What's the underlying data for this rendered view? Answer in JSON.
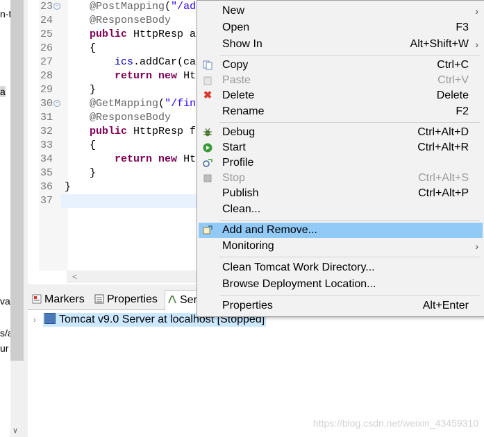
{
  "left_strip": {
    "fragments": [
      "n-t",
      "a",
      "va",
      "s/a",
      "ur"
    ]
  },
  "editor": {
    "lines": [
      {
        "n": "23",
        "fold": true,
        "parts": [
          {
            "t": "    ",
            "c": ""
          },
          {
            "t": "@PostMapping",
            "c": "ann"
          },
          {
            "t": "(",
            "c": ""
          },
          {
            "t": "\"/add",
            "c": "str"
          }
        ]
      },
      {
        "n": "24",
        "fold": false,
        "parts": [
          {
            "t": "    ",
            "c": ""
          },
          {
            "t": "@ResponseBody",
            "c": "ann"
          }
        ]
      },
      {
        "n": "25",
        "fold": false,
        "parts": [
          {
            "t": "    ",
            "c": ""
          },
          {
            "t": "public",
            "c": "kw"
          },
          {
            "t": " HttpResp ad",
            "c": ""
          }
        ]
      },
      {
        "n": "26",
        "fold": false,
        "parts": [
          {
            "t": "    {",
            "c": ""
          }
        ]
      },
      {
        "n": "27",
        "fold": false,
        "parts": [
          {
            "t": "        ",
            "c": ""
          },
          {
            "t": "ics",
            "c": "fld"
          },
          {
            "t": ".addCar(car",
            "c": ""
          }
        ]
      },
      {
        "n": "28",
        "fold": false,
        "parts": [
          {
            "t": "        ",
            "c": ""
          },
          {
            "t": "return",
            "c": "kw"
          },
          {
            "t": " ",
            "c": ""
          },
          {
            "t": "new",
            "c": "kw"
          },
          {
            "t": " Htt",
            "c": ""
          }
        ]
      },
      {
        "n": "29",
        "fold": false,
        "parts": [
          {
            "t": "    }",
            "c": ""
          }
        ]
      },
      {
        "n": "30",
        "fold": true,
        "parts": [
          {
            "t": "    ",
            "c": ""
          },
          {
            "t": "@GetMapping",
            "c": "ann"
          },
          {
            "t": "(",
            "c": ""
          },
          {
            "t": "\"/find",
            "c": "str"
          }
        ]
      },
      {
        "n": "31",
        "fold": false,
        "parts": [
          {
            "t": "    ",
            "c": ""
          },
          {
            "t": "@ResponseBody",
            "c": "ann"
          }
        ]
      },
      {
        "n": "32",
        "fold": false,
        "parts": [
          {
            "t": "    ",
            "c": ""
          },
          {
            "t": "public",
            "c": "kw"
          },
          {
            "t": " HttpResp fi",
            "c": ""
          }
        ]
      },
      {
        "n": "33",
        "fold": false,
        "parts": [
          {
            "t": "    {",
            "c": ""
          }
        ]
      },
      {
        "n": "34",
        "fold": false,
        "parts": [
          {
            "t": "        ",
            "c": ""
          },
          {
            "t": "return",
            "c": "kw"
          },
          {
            "t": " ",
            "c": ""
          },
          {
            "t": "new",
            "c": "kw"
          },
          {
            "t": " Htt",
            "c": ""
          }
        ]
      },
      {
        "n": "35",
        "fold": false,
        "parts": [
          {
            "t": "    }",
            "c": ""
          }
        ]
      },
      {
        "n": "36",
        "fold": false,
        "parts": [
          {
            "t": "}",
            "c": ""
          }
        ]
      },
      {
        "n": "37",
        "fold": false,
        "parts": []
      }
    ]
  },
  "tabs": {
    "markers": "Markers",
    "properties": "Properties",
    "servers": "Ser"
  },
  "servers": {
    "row_label": "Tomcat v9.0 Server at localhost  [Stopped]"
  },
  "watermark": "https://blog.csdn.net/weixin_43459310",
  "menu": {
    "new": {
      "label": "New"
    },
    "open": {
      "label": "Open",
      "shortcut": "F3"
    },
    "show_in": {
      "label": "Show In",
      "shortcut": "Alt+Shift+W"
    },
    "copy": {
      "label": "Copy",
      "shortcut": "Ctrl+C"
    },
    "paste": {
      "label": "Paste",
      "shortcut": "Ctrl+V"
    },
    "delete": {
      "label": "Delete",
      "shortcut": "Delete"
    },
    "rename": {
      "label": "Rename",
      "shortcut": "F2"
    },
    "debug": {
      "label": "Debug",
      "shortcut": "Ctrl+Alt+D"
    },
    "start": {
      "label": "Start",
      "shortcut": "Ctrl+Alt+R"
    },
    "profile": {
      "label": "Profile"
    },
    "stop": {
      "label": "Stop",
      "shortcut": "Ctrl+Alt+S"
    },
    "publish": {
      "label": "Publish",
      "shortcut": "Ctrl+Alt+P"
    },
    "clean": {
      "label": "Clean..."
    },
    "add_remove": {
      "label": "Add and Remove..."
    },
    "monitoring": {
      "label": "Monitoring"
    },
    "clean_tomcat": {
      "label": "Clean Tomcat Work Directory..."
    },
    "browse_deploy": {
      "label": "Browse Deployment Location..."
    },
    "properties": {
      "label": "Properties",
      "shortcut": "Alt+Enter"
    }
  },
  "colors": {
    "menu_highlight": "#91c9f7",
    "keyword": "#7f0055",
    "annotation": "#646464",
    "string": "#2a00ff",
    "selection": "#cce8ff"
  }
}
